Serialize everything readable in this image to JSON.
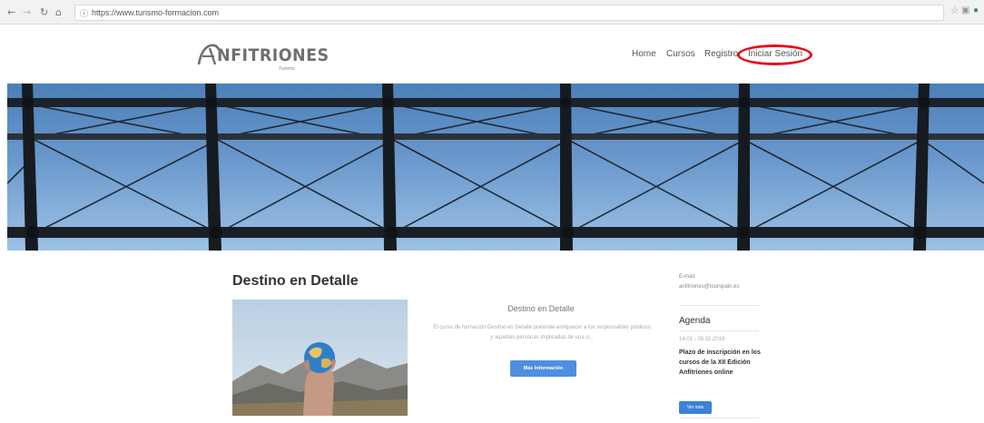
{
  "browser": {
    "back_icon": "back-arrow-icon",
    "forward_icon": "forward-arrow-icon",
    "reload_icon": "reload-icon",
    "home_icon": "home-icon",
    "url": "https://www.turismo-formacion.com"
  },
  "header": {
    "logo_text": "NFITRIONES",
    "logo_sub": "Turismo",
    "menu": [
      "Home",
      "Cursos",
      "Registro",
      "Iniciar Sesión"
    ],
    "highlight_color": "#e0151b"
  },
  "main": {
    "title": "Destino en Detalle",
    "card": {
      "title": "Destino en Detalle",
      "text": "El curso de formación Destino en Detalle pretende enriquecer a los responsables públicos y aquellas personas implicadas de una o...",
      "button": "Más Información",
      "button_color": "#4d8fe0"
    }
  },
  "sidebar": {
    "email_label": "E-mail:",
    "email": "anfitriones@tourspain.es",
    "agenda_title": "Agenda",
    "agenda_date": "14.01 - 28.02.2019",
    "agenda_item": "Plazo de inscripción en los cursos de la XII Edición Anfitriones online",
    "agenda_button": "Ver más"
  }
}
